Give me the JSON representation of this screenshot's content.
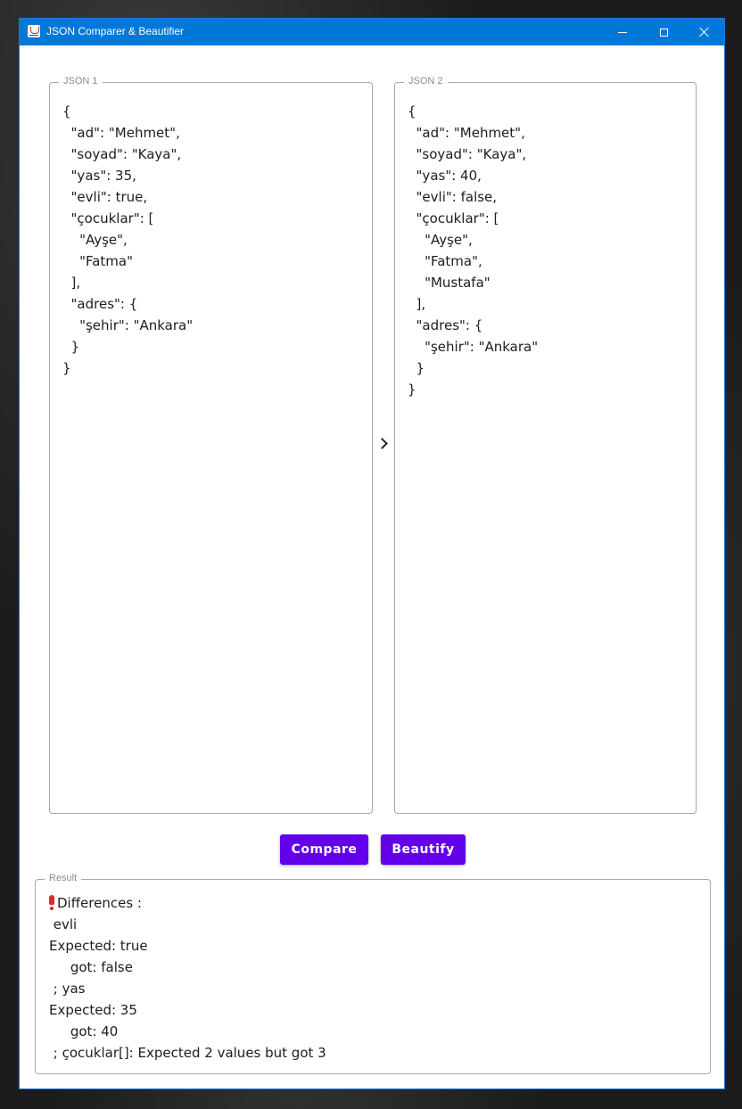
{
  "window": {
    "title": "JSON Comparer & Beautifier"
  },
  "json1": {
    "legend": "JSON 1",
    "text": "{\n  \"ad\": \"Mehmet\",\n  \"soyad\": \"Kaya\",\n  \"yas\": 35,\n  \"evli\": true,\n  \"çocuklar\": [\n    \"Ayşe\",\n    \"Fatma\"\n  ],\n  \"adres\": {\n    \"şehir\": \"Ankara\"\n  }\n}"
  },
  "json2": {
    "legend": "JSON 2",
    "text": "{\n  \"ad\": \"Mehmet\",\n  \"soyad\": \"Kaya\",\n  \"yas\": 40,\n  \"evli\": false,\n  \"çocuklar\": [\n    \"Ayşe\",\n    \"Fatma\",\n    \"Mustafa\"\n  ],\n  \"adres\": {\n    \"şehir\": \"Ankara\"\n  }\n}"
  },
  "buttons": {
    "compare": "Compare",
    "beautify": "Beautify"
  },
  "result": {
    "legend": "Result",
    "heading": "Differences :",
    "body": " evli\nExpected: true\n     got: false\n ; yas\nExpected: 35\n     got: 40\n ; çocuklar[]: Expected 2 values but got 3"
  },
  "icons": {
    "app": "java-cup-icon",
    "minimize": "minimize-icon",
    "maximize": "maximize-icon",
    "close": "close-icon",
    "arrow": "chevron-right-icon",
    "warning": "exclamation-icon"
  },
  "colors": {
    "titlebar": "#0078d7",
    "button": "#6200ea",
    "warning": "#d92b2b"
  }
}
